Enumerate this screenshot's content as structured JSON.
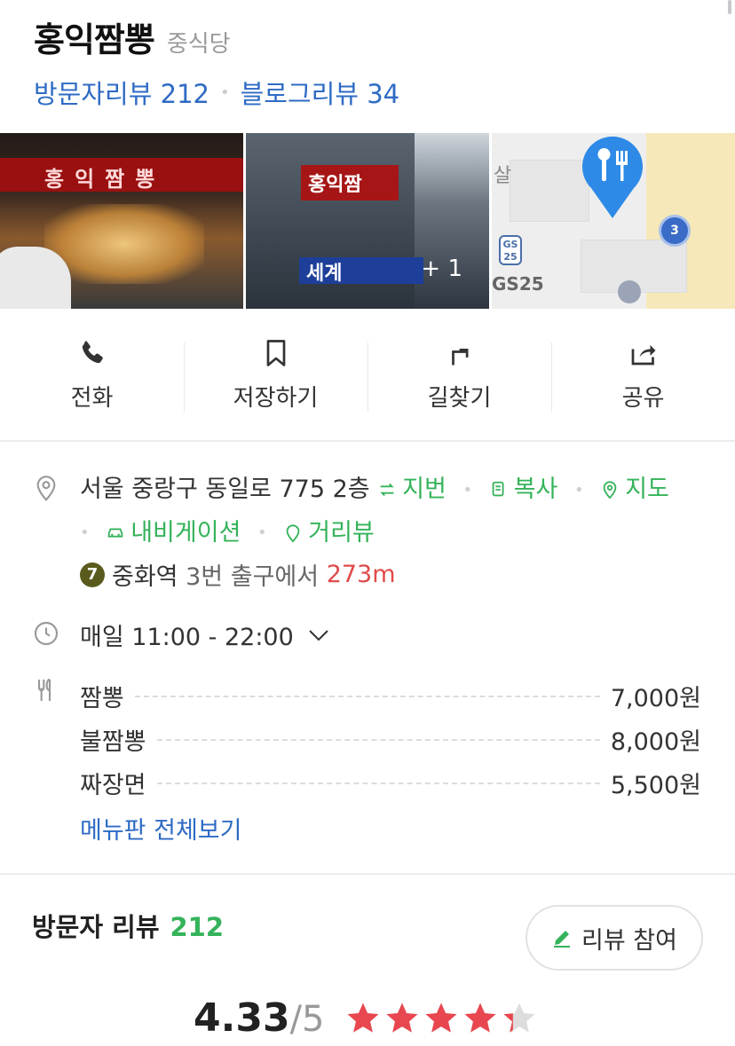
{
  "place": {
    "name": "홍익짬뽕",
    "category": "중식당",
    "visitor_reviews_label": "방문자리뷰 212",
    "blog_reviews_label": "블로그리뷰 34"
  },
  "photos": {
    "more_count": "+ 1",
    "photo1_sign": "홍익짬뽕",
    "photo2_sign": "홍익짬",
    "photo2_sign2": "세계",
    "map_gs": "GS25",
    "map_badge": "3",
    "map_text": "살"
  },
  "actions": [
    {
      "label": "전화",
      "icon": "phone-icon"
    },
    {
      "label": "저장하기",
      "icon": "bookmark-icon"
    },
    {
      "label": "길찾기",
      "icon": "directions-icon"
    },
    {
      "label": "공유",
      "icon": "share-icon"
    }
  ],
  "address": {
    "text": "서울 중랑구 동일로 775 2층",
    "jibun": "지번",
    "copy": "복사",
    "map": "지도",
    "navigation": "내비게이션",
    "streetview": "거리뷰"
  },
  "station": {
    "line": "7",
    "name": "중화역",
    "exit": "3번 출구에서",
    "distance": "273m"
  },
  "hours": {
    "text": "매일 11:00 - 22:00"
  },
  "menu": {
    "items": [
      {
        "name": "짬뽕",
        "price": "7,000원"
      },
      {
        "name": "불짬뽕",
        "price": "8,000원"
      },
      {
        "name": "짜장면",
        "price": "5,500원"
      }
    ],
    "view_all": "메뉴판 전체보기"
  },
  "reviews": {
    "title": "방문자 리뷰",
    "count": "212",
    "write_button": "리뷰 참여",
    "score": "4.33",
    "out_of": "/5",
    "rating_value": 4.33,
    "max_stars": 5
  },
  "colors": {
    "link_blue": "#2e6bc4",
    "green": "#35b35a",
    "red": "#e04b4b",
    "star": "#e8474f"
  }
}
